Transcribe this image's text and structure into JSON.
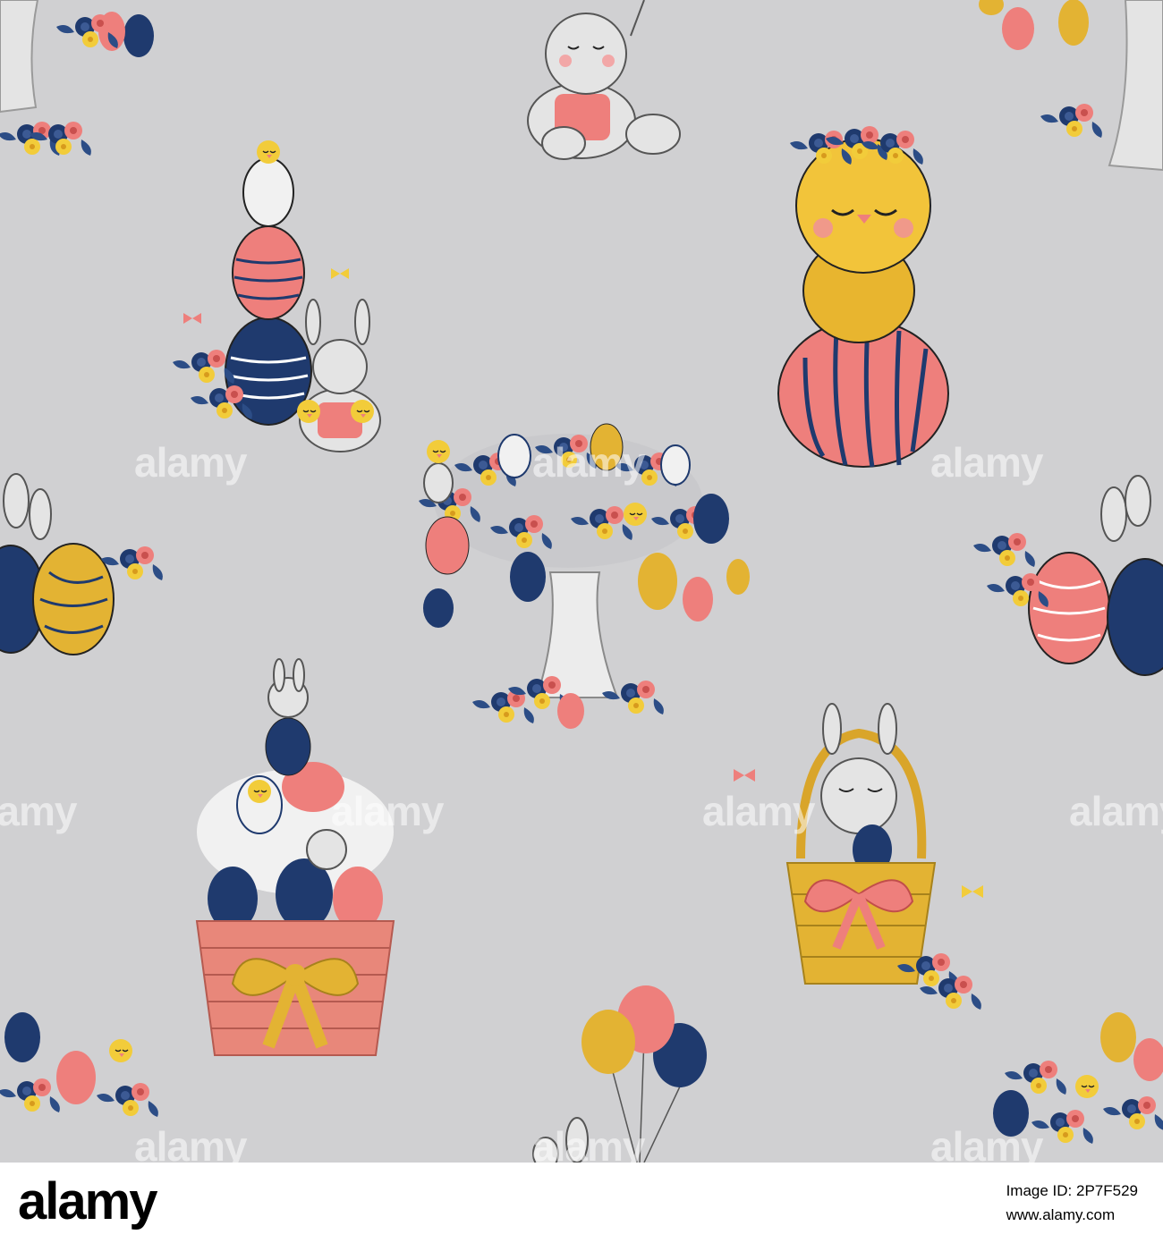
{
  "watermark": {
    "text": "alamy",
    "color": "#ffffff"
  },
  "footer": {
    "logo": "alamy",
    "image_id_line": "Image ID: 2P7F529",
    "site": "www.alamy.com"
  },
  "palette": {
    "background": "#d0d0d2",
    "coral": "#ee7f7c",
    "navy": "#1f3a6e",
    "gold": "#e3b333",
    "yellow": "#f2cc3a",
    "grey": "#e4e4e4"
  },
  "motifs": [
    "rabbit-icon",
    "chick-icon",
    "easter-egg-icon",
    "flower-icon",
    "basket-icon",
    "tree-icon",
    "balloon-icon",
    "butterfly-icon"
  ]
}
